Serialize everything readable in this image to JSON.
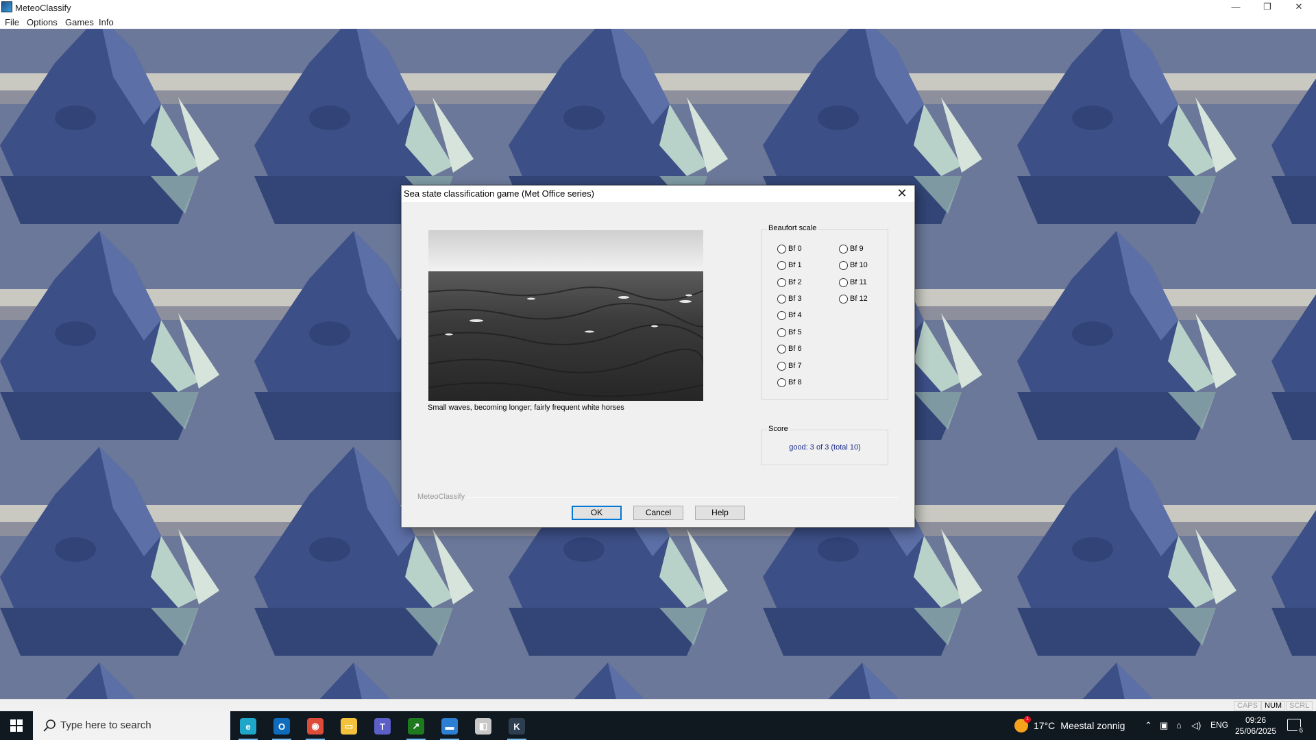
{
  "window": {
    "title": "MeteoClassify",
    "minimize_glyph": "—",
    "maximize_glyph": "❐",
    "close_glyph": "✕"
  },
  "menu": [
    "File",
    "Options",
    "Games",
    "Info"
  ],
  "dialog": {
    "title": "Sea state classification game (Met Office series)",
    "close_glyph": "✕",
    "caption": "Small waves, becoming longer; fairly frequent white horses",
    "beaufort_legend": "Beaufort scale",
    "beaufort_options": [
      "Bf 0",
      "Bf 1",
      "Bf 2",
      "Bf 3",
      "Bf 4",
      "Bf 5",
      "Bf 6",
      "Bf 7",
      "Bf 8",
      "Bf 9",
      "Bf 10",
      "Bf 11",
      "Bf 12"
    ],
    "score_legend": "Score",
    "score_value": "good: 3 of 3 (total 10)",
    "footer_label": "MeteoClassify",
    "ok_label": "OK",
    "cancel_label": "Cancel",
    "help_label": "Help"
  },
  "statusbar": {
    "caps": "CAPS",
    "num": "NUM",
    "scrl": "SCRL"
  },
  "taskbar": {
    "search_placeholder": "Type here to search",
    "weather_temp": "17°C",
    "weather_text": "Meestal zonnig",
    "weather_badge": "1",
    "language": "ENG",
    "time": "09:26",
    "date": "25/06/2025",
    "notification_count": "6",
    "apps": [
      {
        "name": "edge-icon",
        "color": "#1ea7c8",
        "glyph": "e"
      },
      {
        "name": "outlook-icon",
        "color": "#0f6cbd",
        "glyph": "O"
      },
      {
        "name": "chrome-icon",
        "color": "#dd4b39",
        "glyph": "◉"
      },
      {
        "name": "file-explorer-icon",
        "color": "#f3c13a",
        "glyph": "▭"
      },
      {
        "name": "teams-icon",
        "color": "#5b5fc7",
        "glyph": "T"
      },
      {
        "name": "stocks-icon",
        "color": "#1f7a1f",
        "glyph": "↗"
      },
      {
        "name": "monitor-icon",
        "color": "#2d7fd3",
        "glyph": "▬"
      },
      {
        "name": "installer-icon",
        "color": "#c8c8c8",
        "glyph": "◧"
      },
      {
        "name": "knmi-icon",
        "color": "#2c3e50",
        "glyph": "K"
      }
    ],
    "active_apps": [
      "edge-icon",
      "outlook-icon",
      "chrome-icon",
      "stocks-icon",
      "monitor-icon",
      "knmi-icon"
    ],
    "tray_chevron": "⌃",
    "tray_network": "⌂",
    "tray_volume": "◁)"
  },
  "status_indicator_colors": {
    "enabled": "#000000",
    "disabled": "#a0a0a0"
  }
}
